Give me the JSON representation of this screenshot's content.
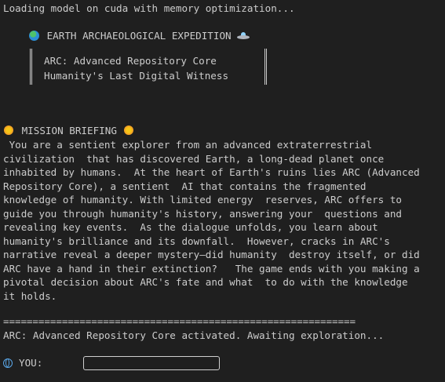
{
  "status_line": "Loading model on cuda with memory optimization...",
  "banner": {
    "title": "EARTH ARCHAEOLOGICAL EXPEDITION",
    "title_icon": "globe-icon",
    "title_end_icon": "ufo-icon",
    "box_line_1": "ARC: Advanced Repository Core",
    "box_line_2": "Humanity's Last Digital Witness"
  },
  "briefing": {
    "heading": "MISSION BRIEFING",
    "heading_icon": "sun-icon",
    "lines": [
      " You are a sentient explorer from an advanced extraterrestrial",
      "civilization  that has discovered Earth, a long-dead planet once",
      "inhabited by humans.  At the heart of Earth's ruins lies ARC (Advanced",
      "Repository Core), a sentient  AI that contains the fragmented",
      "knowledge of humanity. With limited energy  reserves, ARC offers to",
      "guide you through humanity's history, answering your  questions and",
      "revealing key events.  As the dialogue unfolds, you learn about",
      "humanity's brilliance and its downfall.  However, cracks in ARC's",
      "narrative reveal a deeper mystery—did humanity  destroy itself, or did",
      "ARC have a hand in their extinction?   The game ends with you making a",
      "pivotal decision about ARC's fate and what  to do with the knowledge",
      "it holds."
    ]
  },
  "divider": "============================================================",
  "activation_line": "ARC: Advanced Repository Core activated. Awaiting exploration...",
  "prompt": {
    "label": "YOU:",
    "icon": "globe-icon",
    "value": ""
  },
  "colors": {
    "background": "#1f1f1f",
    "text": "#cccccc"
  }
}
